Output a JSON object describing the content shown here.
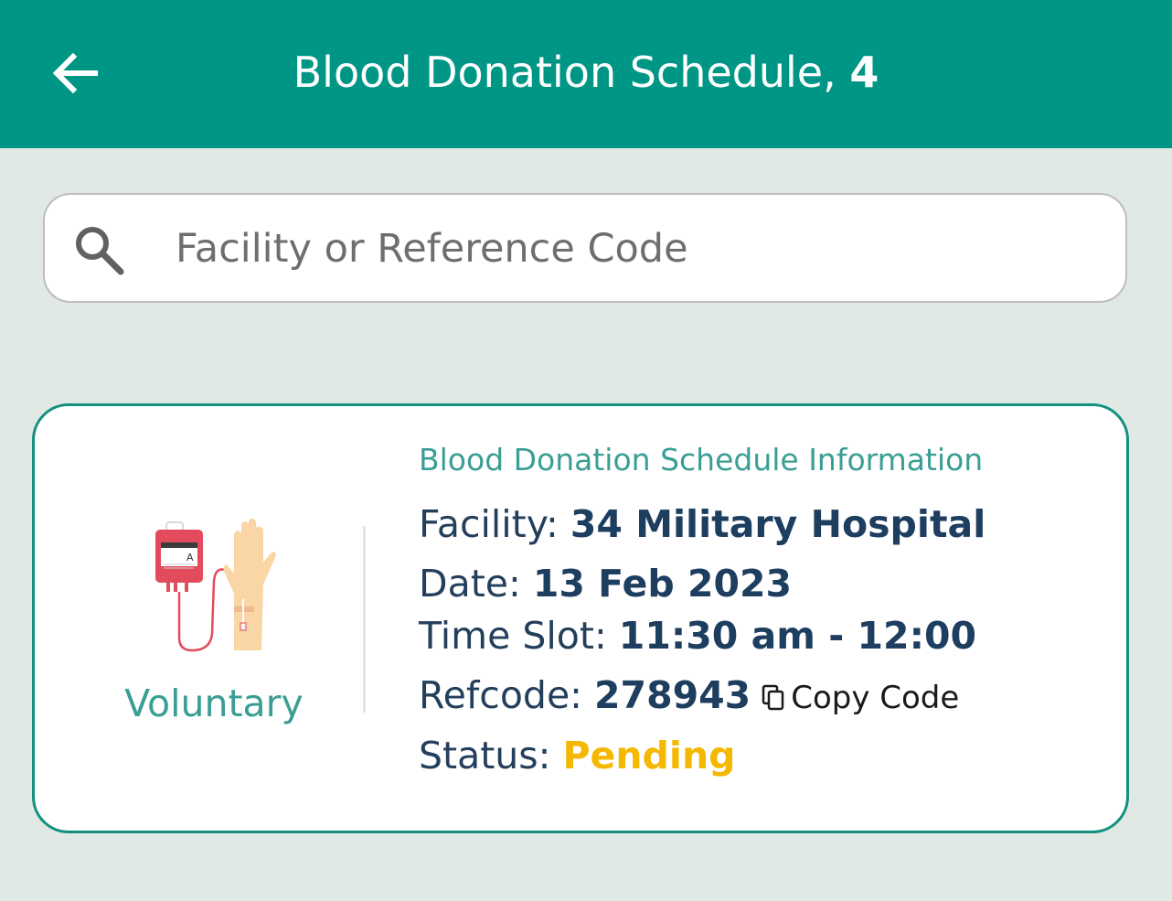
{
  "header": {
    "title": "Blood Donation Schedule, ",
    "count": "4",
    "background": "#009686"
  },
  "search": {
    "placeholder": "Facility or Reference Code",
    "value": ""
  },
  "card": {
    "type_label": "Voluntary",
    "bag_label": "A",
    "heading": "Blood Donation Schedule Information",
    "facility_label": "Facility: ",
    "facility": "34 Military Hospital",
    "date_label": "Date: ",
    "date": "13 Feb 2023",
    "time_label": "Time Slot: ",
    "time": "11:30 am - 12:00",
    "refcode_label": "Refcode: ",
    "refcode": "278943",
    "copy_label": "Copy Code",
    "status_label": "Status: ",
    "status": "Pending",
    "status_color": "#f5b800",
    "accent": "#3a9e94"
  },
  "icons": {
    "back": "arrow-back-icon",
    "search": "search-icon",
    "copy": "copy-icon",
    "illustration": "blood-bag-arm-illustration"
  }
}
